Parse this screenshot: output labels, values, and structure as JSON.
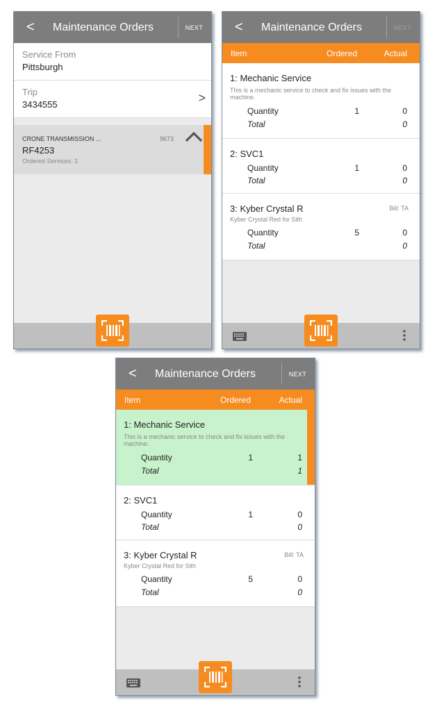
{
  "common": {
    "back": "<",
    "title": "Maintenance Orders",
    "next": "NEXT",
    "icons": {
      "back": "back-chevron-icon",
      "barcode": "barcode-scan-icon",
      "keyboard": "keyboard-icon",
      "menu": "more-vert-icon",
      "expand": "chevron-up-icon",
      "navigate": "chevron-right-icon"
    },
    "colors": {
      "accent": "#f68b1f",
      "header": "#7d7d7d",
      "highlight": "#c8f2cc",
      "bottom_bar": "#bfbfbf"
    }
  },
  "screen1": {
    "service_from": {
      "label": "Service From",
      "value": "Pittsburgh"
    },
    "trip": {
      "label": "Trip",
      "value": "3434555",
      "chevron": ">"
    },
    "order_card": {
      "customer": "CRONE TRANSMISSION ...",
      "number": "9673",
      "order_id": "RF4253",
      "services": "Ordered Services: 2"
    }
  },
  "columns": {
    "item": "Item",
    "ordered": "Ordered",
    "actual": "Actual"
  },
  "screen2": {
    "items": [
      {
        "name": "1: Mechanic Service",
        "description": "This is a mechanic service to check and fix issues with the machine.",
        "qty_label": "Quantity",
        "ordered": "1",
        "actual": "0",
        "total_label": "Total",
        "total": "0"
      },
      {
        "name": "2: SVC1",
        "qty_label": "Quantity",
        "ordered": "1",
        "actual": "0",
        "total_label": "Total",
        "total": "0"
      },
      {
        "name": "3: Kyber Crystal R",
        "bill": "Bill: TA",
        "description": "Kyber Crystal Red for Sith",
        "qty_label": "Quantity",
        "ordered": "5",
        "actual": "0",
        "total_label": "Total",
        "total": "0"
      }
    ]
  },
  "screen3": {
    "items": [
      {
        "name": "1: Mechanic Service",
        "description": "This is a mechanic service to check and fix issues with the machine.",
        "qty_label": "Quantity",
        "ordered": "1",
        "actual": "1",
        "total_label": "Total",
        "total": "1"
      },
      {
        "name": "2: SVC1",
        "qty_label": "Quantity",
        "ordered": "1",
        "actual": "0",
        "total_label": "Total",
        "total": "0"
      },
      {
        "name": "3: Kyber Crystal R",
        "bill": "Bill: TA",
        "description": "Kyber Crystal Red for Sith",
        "qty_label": "Quantity",
        "ordered": "5",
        "actual": "0",
        "total_label": "Total",
        "total": "0"
      }
    ]
  }
}
